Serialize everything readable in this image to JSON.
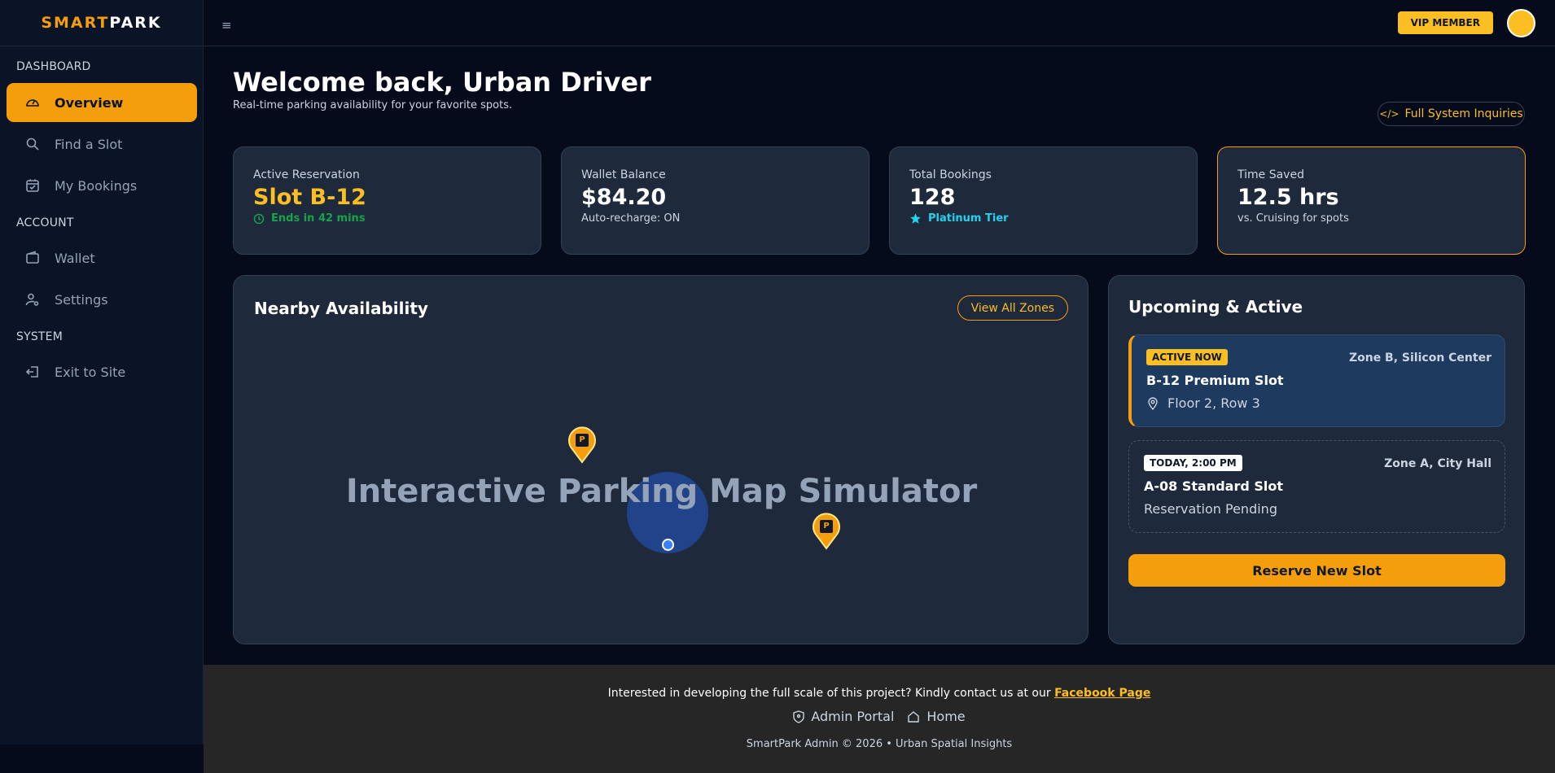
{
  "brand": {
    "part1": "SMART",
    "part2": "PARK"
  },
  "sidebar": {
    "sections": [
      {
        "label": "DASHBOARD"
      },
      {
        "label": "ACCOUNT"
      },
      {
        "label": "SYSTEM"
      }
    ],
    "items": [
      {
        "label": "Overview",
        "icon": "speedometer-icon",
        "active": true
      },
      {
        "label": "Find a Slot",
        "icon": "search-icon"
      },
      {
        "label": "My Bookings",
        "icon": "calendar-check-icon"
      },
      {
        "label": "Wallet",
        "icon": "wallet-icon"
      },
      {
        "label": "Settings",
        "icon": "user-gear-icon"
      },
      {
        "label": "Exit to Site",
        "icon": "exit-icon"
      }
    ]
  },
  "topbar": {
    "menu_icon": "≡",
    "vip_label": "VIP MEMBER"
  },
  "header": {
    "title": "Welcome back, Urban Driver",
    "subtitle": "Real-time parking availability for your favorite spots.",
    "inquiry_label": "Full System Inquiries"
  },
  "stats": [
    {
      "label": "Active Reservation",
      "value": "Slot B-12",
      "sub": "Ends in 42 mins"
    },
    {
      "label": "Wallet Balance",
      "value": "$84.20",
      "sub": "Auto-recharge: ON"
    },
    {
      "label": "Total Bookings",
      "value": "128",
      "sub": "Platinum Tier"
    },
    {
      "label": "Time Saved",
      "value": "12.5 hrs",
      "sub": "vs. Cruising for spots"
    }
  ],
  "map": {
    "title": "Nearby Availability",
    "zones_button": "View All Zones",
    "placeholder": "Interactive Parking Map Simulator",
    "pin_label": "P"
  },
  "bookings": {
    "title": "Upcoming & Active",
    "items": [
      {
        "badge": "ACTIVE NOW",
        "zone": "Zone B, Silicon Center",
        "name": "B-12 Premium Slot",
        "detail": "Floor 2, Row 3"
      },
      {
        "badge": "TODAY, 2:00 PM",
        "zone": "Zone A, City Hall",
        "name": "A-08 Standard Slot",
        "detail": "Reservation Pending"
      }
    ],
    "reserve_label": "Reserve New Slot"
  },
  "footer": {
    "contact_text": "Interested in developing the full scale of this project? Kindly contact us at our ",
    "contact_link": "Facebook Page",
    "links": [
      {
        "label": "Admin Portal"
      },
      {
        "label": "Home"
      }
    ],
    "copyright": "SmartPark Admin © 2026 • Urban Spatial Insights"
  },
  "colors": {
    "accent": "#f59e0b",
    "accent_light": "#fbbf24",
    "background": "#050b1a",
    "card": "#1e293b",
    "success": "#16a34a",
    "info": "#22d3ee"
  }
}
